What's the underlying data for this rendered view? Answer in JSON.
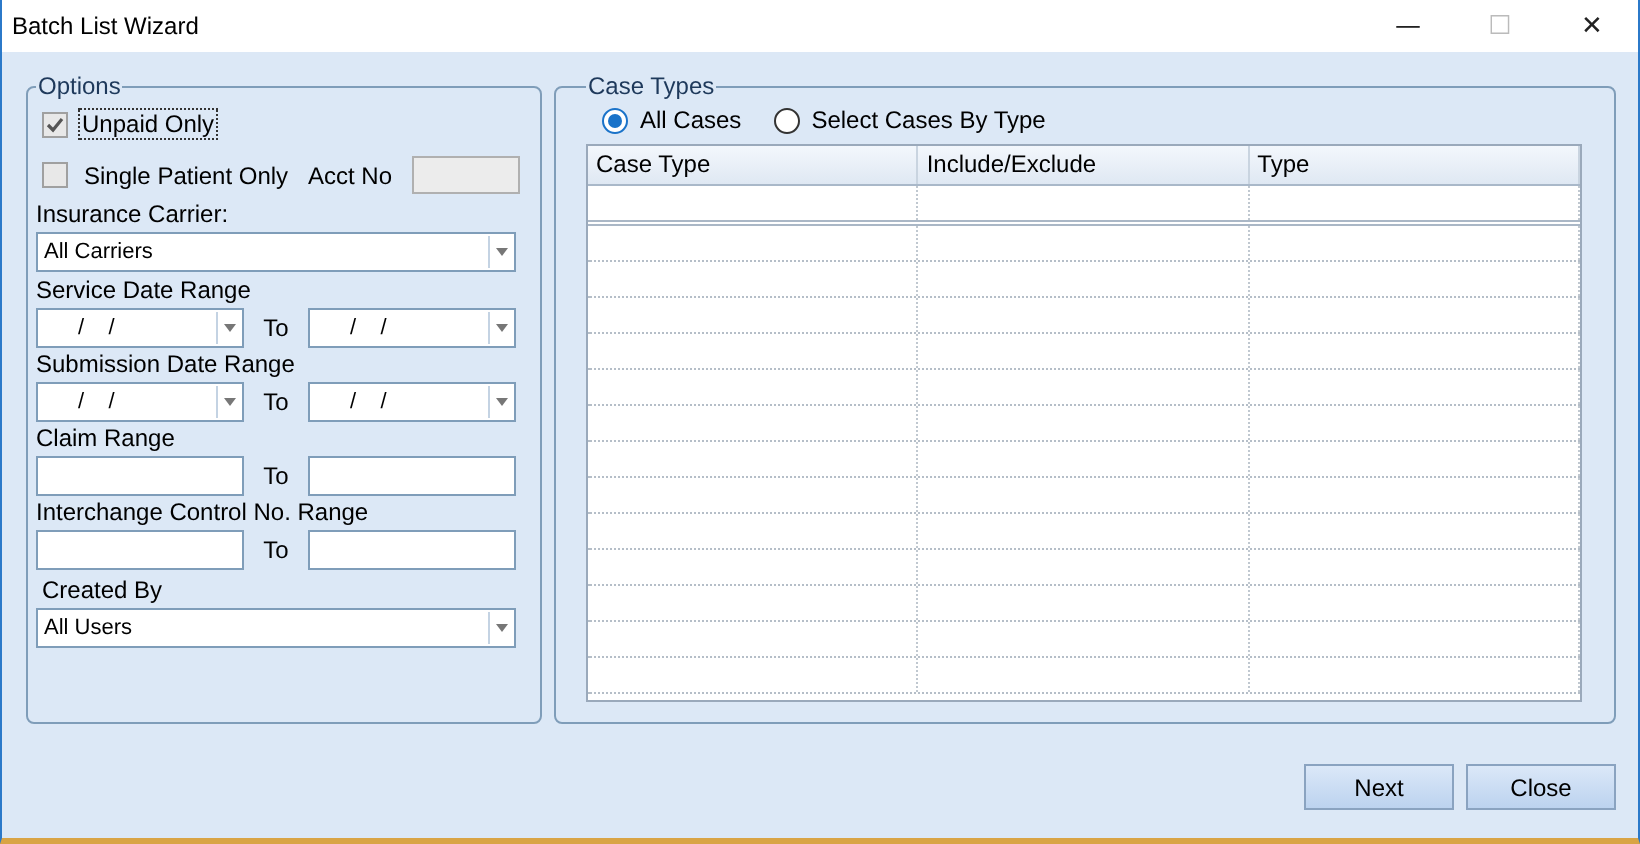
{
  "window": {
    "title": "Batch List Wizard",
    "controls": [
      "—",
      "☐",
      "✕"
    ]
  },
  "options": {
    "title": "Options",
    "unpaid_only": {
      "label": "Unpaid Only",
      "checked": true
    },
    "single_patient": {
      "label": "Single Patient Only",
      "checked": false
    },
    "acct_no": {
      "label": "Acct No",
      "disabled": true
    },
    "insurance_carrier": {
      "label": "Insurance Carrier:",
      "value": "All Carriers"
    },
    "service_date": {
      "label": "Service Date Range",
      "from": "/    /",
      "to_label": "To",
      "to": "/    /"
    },
    "submission_date": {
      "label": "Submission Date Range",
      "from": "/    /",
      "to_label": "To",
      "to": "/    /"
    },
    "claim_range": {
      "label": "Claim Range",
      "to_label": "To"
    },
    "interchange_range": {
      "label": "Interchange Control No. Range",
      "to_label": "To"
    },
    "created_by": {
      "label": "Created By",
      "value": "All Users"
    }
  },
  "case_types": {
    "title": "Case Types",
    "radios": [
      {
        "label": "All Cases",
        "selected": true
      },
      {
        "label": "Select Cases By Type",
        "selected": false
      }
    ],
    "table": {
      "columns": [
        "Case Type",
        "Include/Exclude",
        "Type"
      ]
    }
  },
  "buttons": [
    "Next",
    "Close"
  ]
}
